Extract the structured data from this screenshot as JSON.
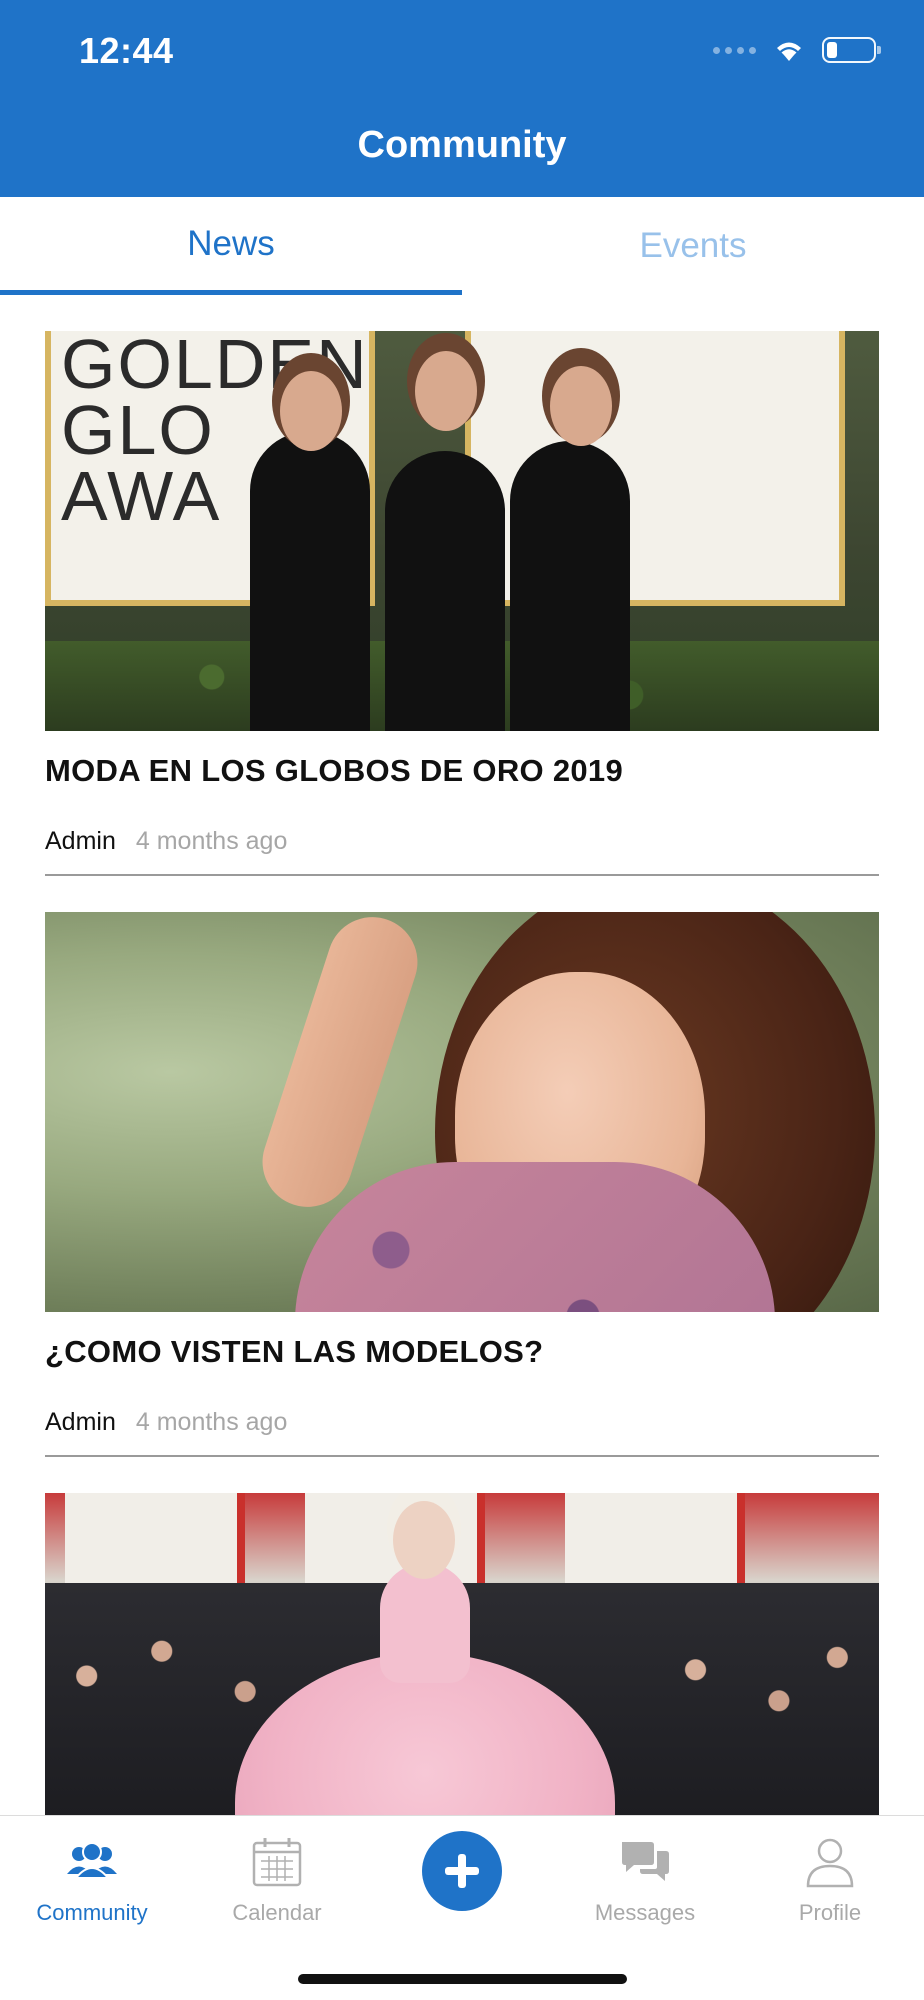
{
  "status_bar": {
    "time": "12:44"
  },
  "header": {
    "title": "Community",
    "background_color": "#1f73c8"
  },
  "tabs": [
    {
      "label": "News",
      "active": true
    },
    {
      "label": "Events",
      "active": false
    }
  ],
  "feed": [
    {
      "title": "MODA EN LOS GLOBOS DE ORO 2019",
      "author": "Admin",
      "time": "4 months ago",
      "image_text": "GOLDEN\nGLO\nAWA"
    },
    {
      "title": "¿COMO VISTEN LAS MODELOS?",
      "author": "Admin",
      "time": "4 months ago"
    }
  ],
  "bottom_nav": {
    "items": [
      {
        "label": "Community",
        "icon": "community-icon",
        "active": true
      },
      {
        "label": "Calendar",
        "icon": "calendar-icon",
        "active": false
      },
      {
        "label": "Messages",
        "icon": "messages-icon",
        "active": false
      },
      {
        "label": "Profile",
        "icon": "profile-icon",
        "active": false
      }
    ],
    "fab_icon": "plus-icon"
  },
  "colors": {
    "accent": "#1f73c8",
    "inactive_tab": "#98c1ea",
    "muted_text": "#a6a6a6"
  }
}
